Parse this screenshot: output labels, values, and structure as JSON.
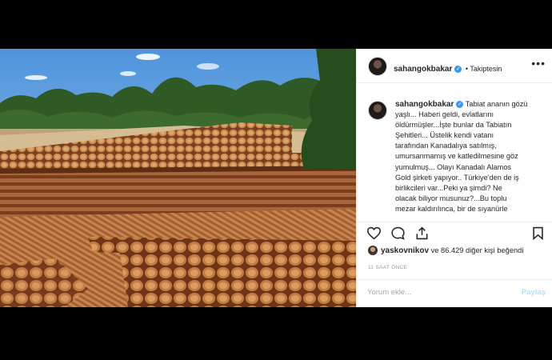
{
  "post": {
    "username": "sahangokbakar",
    "follow_status": "• Takiptesin",
    "more_label": "•••",
    "verified_glyph": "✓",
    "caption_lines": [
      "Tabiat ananın gözü",
      "yaşlı... Haberi geldi, evlatlarını",
      "öldürmüşler...İşte bunlar da Tabiatın",
      "Şehitleri... Üstelik kendi vatanı",
      "tarafından Kanadalıya satılmış,",
      "umursanmamış ve katledilmesine göz",
      "yumulmuş... Olayı Kanadalı Alamos",
      "Gold şirketi yapıyor.. Türkiye'den de iş",
      "birlikcileri var...Peki ya şimdi? Ne",
      "olacak biliyor musunuz?...Bu toplu",
      "mezar kaldırılınca, bir de sıyanürle"
    ],
    "likes_user": "yaskovnikov",
    "likes_rest": "ve 86.429 diğer kişi beğendi",
    "time_ago": "11 SAAT ÖNCE",
    "comment_placeholder": "Yorum ekle...",
    "post_button": "Paylaş"
  },
  "colors": {
    "verified": "#3897f0",
    "post_button_disabled": "#b2dffc"
  }
}
